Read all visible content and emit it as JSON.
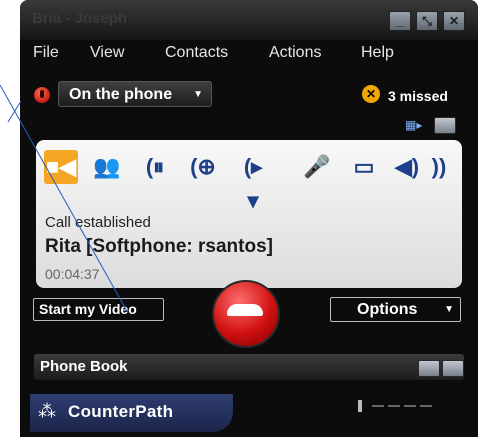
{
  "window": {
    "title": "Bria - Joseph"
  },
  "menu": [
    "File",
    "View",
    "Contacts",
    "Actions",
    "Help"
  ],
  "status": {
    "value": "On the phone"
  },
  "missed": {
    "text": "3 missed"
  },
  "call": {
    "state": "Call established",
    "name": "Rita [Softphone: rsantos]",
    "duration": "00:04:37"
  },
  "buttons": {
    "video": "Start my Video",
    "options": "Options"
  },
  "phonebook": {
    "label": "Phone Book"
  },
  "brand": {
    "name": "CounterPath"
  },
  "toolbar_icons": [
    "video-icon",
    "conference-icon",
    "hold-icon",
    "add-call-icon",
    "transfer-icon",
    "mute-icon",
    "record-icon",
    "speaker-icon",
    "volume-icon"
  ],
  "colors": {
    "accent": "#f5a623",
    "hangup": "#d01010",
    "brand_bg": "#24305e"
  }
}
